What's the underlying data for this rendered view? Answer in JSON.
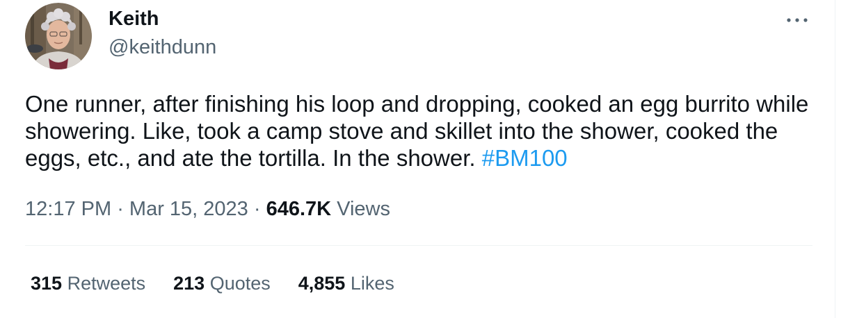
{
  "author": {
    "display_name": "Keith",
    "handle": "@keithdunn"
  },
  "tweet": {
    "text_before_hashtag": "One runner, after finishing his loop and dropping, cooked an egg burrito while showering. Like, took a camp stove and skillet into the shower, cooked the eggs, etc., and ate the tortilla. In the shower. ",
    "hashtag": "#BM100"
  },
  "meta": {
    "time": "12:17 PM",
    "separator": " · ",
    "date": "Mar 15, 2023",
    "views_count": "646.7K",
    "views_label": " Views"
  },
  "stats": [
    {
      "count": "315",
      "label": " Retweets"
    },
    {
      "count": "213",
      "label": " Quotes"
    },
    {
      "count": "4,855",
      "label": " Likes"
    }
  ],
  "icons": {
    "more": "more-options-icon"
  },
  "colors": {
    "text_primary": "#0f1419",
    "text_secondary": "#536471",
    "accent": "#1d9bf0",
    "divider": "#eff3f4"
  }
}
